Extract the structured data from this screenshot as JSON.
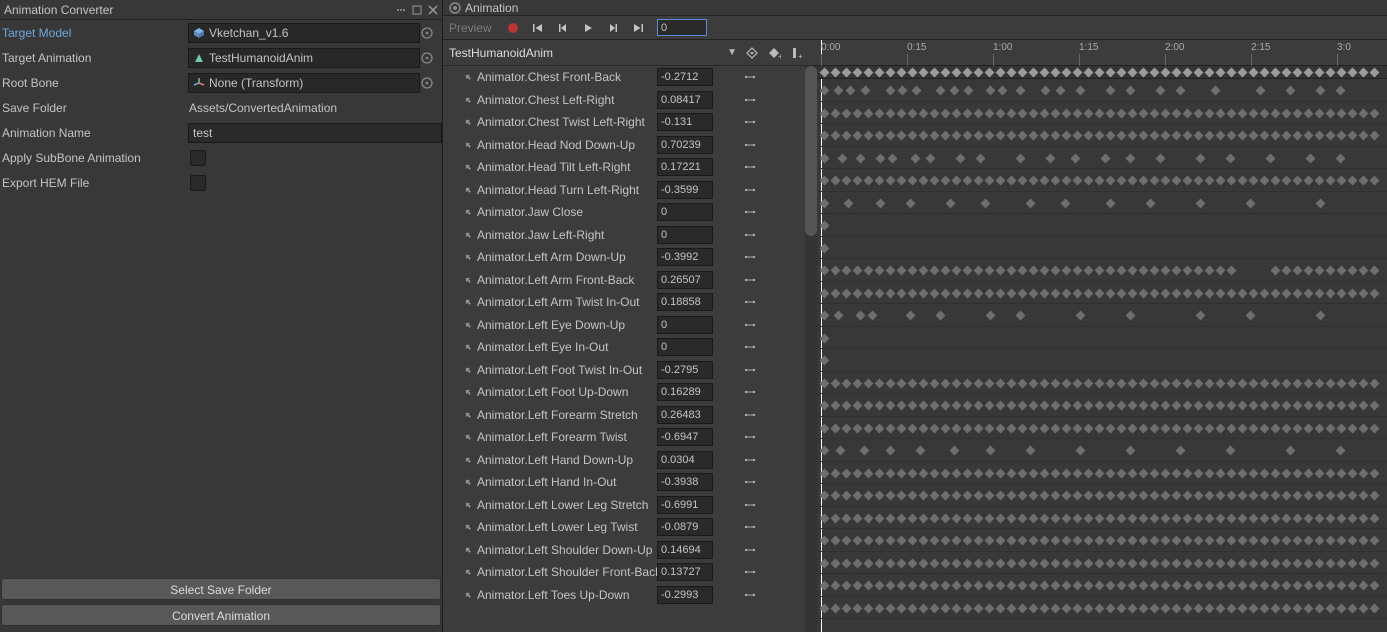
{
  "converter": {
    "title": "Animation Converter",
    "fields": {
      "targetModel": {
        "label": "Target Model",
        "value": "Vketchan_v1.6",
        "icon": "cube",
        "picker": true
      },
      "targetAnim": {
        "label": "Target Animation",
        "value": "TestHumanoidAnim",
        "icon": "anim",
        "picker": true
      },
      "rootBone": {
        "label": "Root Bone",
        "value": "None (Transform)",
        "icon": "bone",
        "picker": true
      },
      "saveFolder": {
        "label": "Save Folder",
        "value": "Assets/ConvertedAnimation"
      },
      "animName": {
        "label": "Animation Name",
        "value": "test"
      },
      "applySub": {
        "label": "Apply SubBone Animation",
        "checked": false
      },
      "exportHem": {
        "label": "Export HEM File",
        "checked": false
      }
    },
    "buttons": {
      "select": "Select Save Folder",
      "convert": "Convert Animation"
    }
  },
  "animation": {
    "tab": "Animation",
    "preview": "Preview",
    "frame_value": "0",
    "clip": "TestHumanoidAnim",
    "ruler_ticks": [
      "0:00",
      "0:15",
      "1:00",
      "1:15",
      "2:00",
      "2:15",
      "3:0"
    ],
    "properties": [
      {
        "name": "Animator.Chest Front-Back",
        "val": "-0.2712",
        "keys": "sparse_a"
      },
      {
        "name": "Animator.Chest Left-Right",
        "val": "0.08417",
        "keys": "dense"
      },
      {
        "name": "Animator.Chest Twist Left-Right",
        "val": "-0.131",
        "keys": "dense"
      },
      {
        "name": "Animator.Head Nod Down-Up",
        "val": "0.70239",
        "keys": "sparse_b"
      },
      {
        "name": "Animator.Head Tilt Left-Right",
        "val": "0.17221",
        "keys": "dense"
      },
      {
        "name": "Animator.Head Turn Left-Right",
        "val": "-0.3599",
        "keys": "sparse_c"
      },
      {
        "name": "Animator.Jaw Close",
        "val": "0",
        "keys": "single"
      },
      {
        "name": "Animator.Jaw Left-Right",
        "val": "0",
        "keys": "single"
      },
      {
        "name": "Animator.Left Arm Down-Up",
        "val": "-0.3992",
        "keys": "dense_wgap"
      },
      {
        "name": "Animator.Left Arm Front-Back",
        "val": "0.26507",
        "keys": "dense"
      },
      {
        "name": "Animator.Left Arm Twist In-Out",
        "val": "0.18858",
        "keys": "sparse_d"
      },
      {
        "name": "Animator.Left Eye Down-Up",
        "val": "0",
        "keys": "single"
      },
      {
        "name": "Animator.Left Eye In-Out",
        "val": "0",
        "keys": "single"
      },
      {
        "name": "Animator.Left Foot Twist In-Out",
        "val": "-0.2795",
        "keys": "dense"
      },
      {
        "name": "Animator.Left Foot Up-Down",
        "val": "0.16289",
        "keys": "dense"
      },
      {
        "name": "Animator.Left Forearm Stretch",
        "val": "0.26483",
        "keys": "dense"
      },
      {
        "name": "Animator.Left Forearm Twist",
        "val": "-0.6947",
        "keys": "sparse_e"
      },
      {
        "name": "Animator.Left Hand Down-Up",
        "val": "0.0304",
        "keys": "dense"
      },
      {
        "name": "Animator.Left Hand In-Out",
        "val": "-0.3938",
        "keys": "dense"
      },
      {
        "name": "Animator.Left Lower Leg Stretch",
        "val": "-0.6991",
        "keys": "dense"
      },
      {
        "name": "Animator.Left Lower Leg Twist",
        "val": "-0.0879",
        "keys": "dense"
      },
      {
        "name": "Animator.Left Shoulder Down-Up",
        "val": "0.14694",
        "keys": "dense"
      },
      {
        "name": "Animator.Left Shoulder Front-Back",
        "val": "0.13727",
        "keys": "dense"
      },
      {
        "name": "Animator.Left Toes Up-Down",
        "val": "-0.2993",
        "keys": "dense"
      }
    ]
  }
}
